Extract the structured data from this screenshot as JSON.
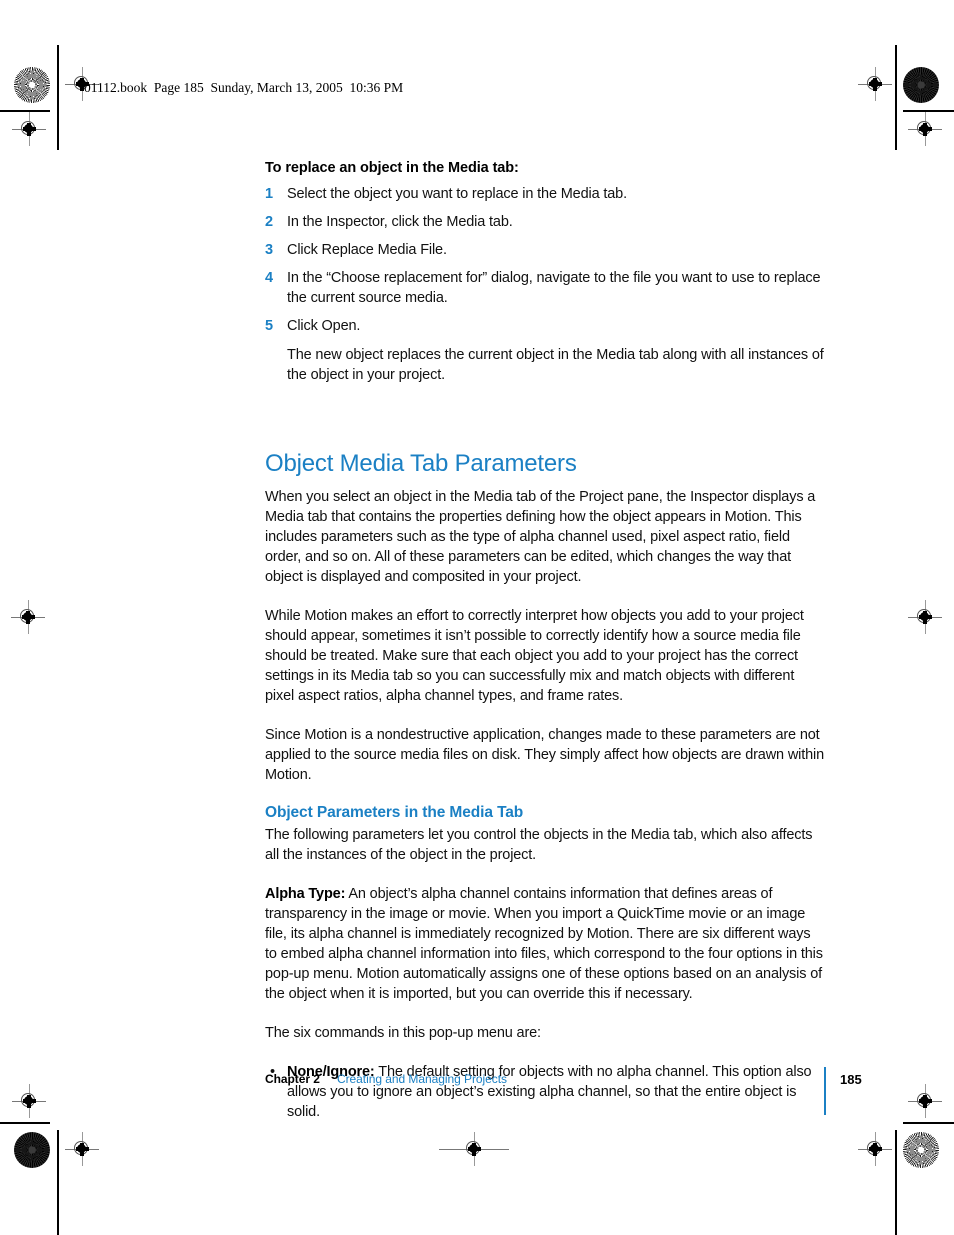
{
  "print_marks": {
    "registration_icon": "registration-crosshair-icon",
    "rosette_icon": "color-rosette-icon"
  },
  "header": {
    "slug": "01112.book  Page 185  Sunday, March 13, 2005  10:36 PM"
  },
  "procedure": {
    "title": "To replace an object in the Media tab:",
    "steps": [
      {
        "num": "1",
        "text": "Select the object you want to replace in the Media tab."
      },
      {
        "num": "2",
        "text": "In the Inspector, click the Media tab."
      },
      {
        "num": "3",
        "text": "Click Replace Media File."
      },
      {
        "num": "4",
        "text": "In the “Choose replacement for” dialog, navigate to the file you want to use to replace the current source media."
      },
      {
        "num": "5",
        "text": "Click Open."
      }
    ],
    "result": "The new object replaces the current object in the Media tab along with all instances of the object in your project."
  },
  "section": {
    "heading": "Object Media Tab Parameters",
    "paragraphs": [
      "When you select an object in the Media tab of the Project pane, the Inspector displays a Media tab that contains the properties defining how the object appears in Motion. This includes parameters such as the type of alpha channel used, pixel aspect ratio, field order, and so on. All of these parameters can be edited, which changes the way that object is displayed and composited in your project.",
      "While Motion makes an effort to correctly interpret how objects you add to your project should appear, sometimes it isn’t possible to correctly identify how a source media file should be treated. Make sure that each object you add to your project has the correct settings in its Media tab so you can successfully mix and match objects with different pixel aspect ratios, alpha channel types, and frame rates.",
      "Since Motion is a nondestructive application, changes made to these parameters are not applied to the source media files on disk. They simply affect how objects are drawn within Motion."
    ]
  },
  "subsection": {
    "heading": "Object Parameters in the Media Tab",
    "intro": "The following parameters let you control the objects in the Media tab, which also affects all the instances of the object in the project.",
    "alpha_type_label": "Alpha Type:",
    "alpha_type_text": " An object’s alpha channel contains information that defines areas of transparency in the image or movie. When you import a QuickTime movie or an image file, its alpha channel is immediately recognized by Motion. There are six different ways to embed alpha channel information into files, which correspond to the four options in this pop-up menu. Motion automatically assigns one of these options based on an analysis of the object when it is imported, but you can override this if necessary.",
    "commands_intro": "The six commands in this pop-up menu are:",
    "bullet_marker": "•",
    "commands": [
      {
        "label": "None/Ignore:",
        "text": " The default setting for objects with no alpha channel. This option also allows you to ignore an object’s existing alpha channel, so that the entire object is solid."
      }
    ]
  },
  "footer": {
    "chapter": "Chapter 2",
    "chapter_title": "Creating and Managing Projects",
    "page_number": "185"
  },
  "colors": {
    "accent_blue": "#1b80c4",
    "text_black": "#111111"
  }
}
